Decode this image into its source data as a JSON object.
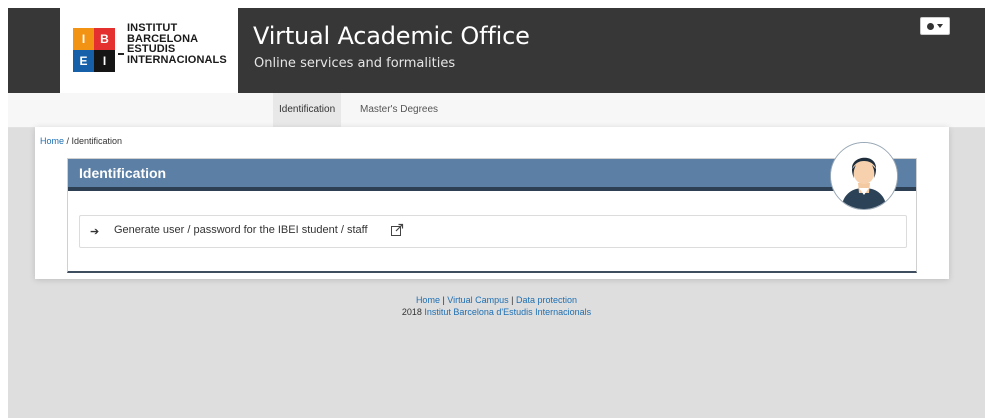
{
  "header": {
    "logo": {
      "cells": [
        "I",
        "B",
        "E",
        "I"
      ],
      "lines": [
        "INSTITUT",
        "BARCELONA",
        "ESTUDIS",
        "INTERNACIONALS"
      ]
    },
    "title": "Virtual Academic Office",
    "subtitle": "Online services and formalities",
    "language_icon": "globe-icon"
  },
  "nav": {
    "items": [
      {
        "label": "Identification",
        "active": true
      },
      {
        "label": "Master's Degrees",
        "active": false
      }
    ]
  },
  "breadcrumb": {
    "home": "Home",
    "separator": " / ",
    "current": "Identification"
  },
  "card": {
    "title": "Identification",
    "avatar_icon": "user-avatar-icon",
    "links": [
      {
        "icon": "arrow-right-icon",
        "text": "Generate user / password for the IBEI student / staff",
        "trailing_icon": "external-link-icon"
      }
    ]
  },
  "footer": {
    "links": [
      "Home",
      "Virtual Campus",
      "Data protection"
    ],
    "separator": " | ",
    "year": "2018",
    "institution": "Institut Barcelona d'Estudis Internacionals"
  },
  "colors": {
    "header_bg": "#373737",
    "card_header": "#5c7fa5",
    "link": "#1f6fb2",
    "logo_orange": "#f29313",
    "logo_red": "#e53030",
    "logo_blue": "#1560a8",
    "logo_black": "#151515"
  }
}
